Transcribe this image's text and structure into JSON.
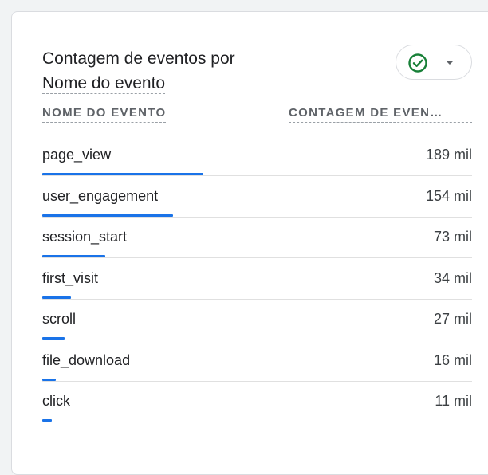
{
  "card": {
    "title_line1": "Contagem de eventos por",
    "title_line2": "Nome do evento"
  },
  "status": {
    "icon": "check-circle-icon",
    "color": "#188038",
    "menu_icon": "caret-down-icon"
  },
  "table": {
    "headers": [
      "NOME DO EVENTO",
      "CONTAGEM DE EVEN…"
    ],
    "accent_color": "#1a73e8",
    "rows": [
      {
        "name": "page_view",
        "count": "189 mil",
        "share": 1.0
      },
      {
        "name": "user_engagement",
        "count": "154 mil",
        "share": 0.81
      },
      {
        "name": "session_start",
        "count": "73 mil",
        "share": 0.39
      },
      {
        "name": "first_visit",
        "count": "34 mil",
        "share": 0.18
      },
      {
        "name": "scroll",
        "count": "27 mil",
        "share": 0.14
      },
      {
        "name": "file_download",
        "count": "16 mil",
        "share": 0.085
      },
      {
        "name": "click",
        "count": "11 mil",
        "share": 0.06
      }
    ]
  }
}
